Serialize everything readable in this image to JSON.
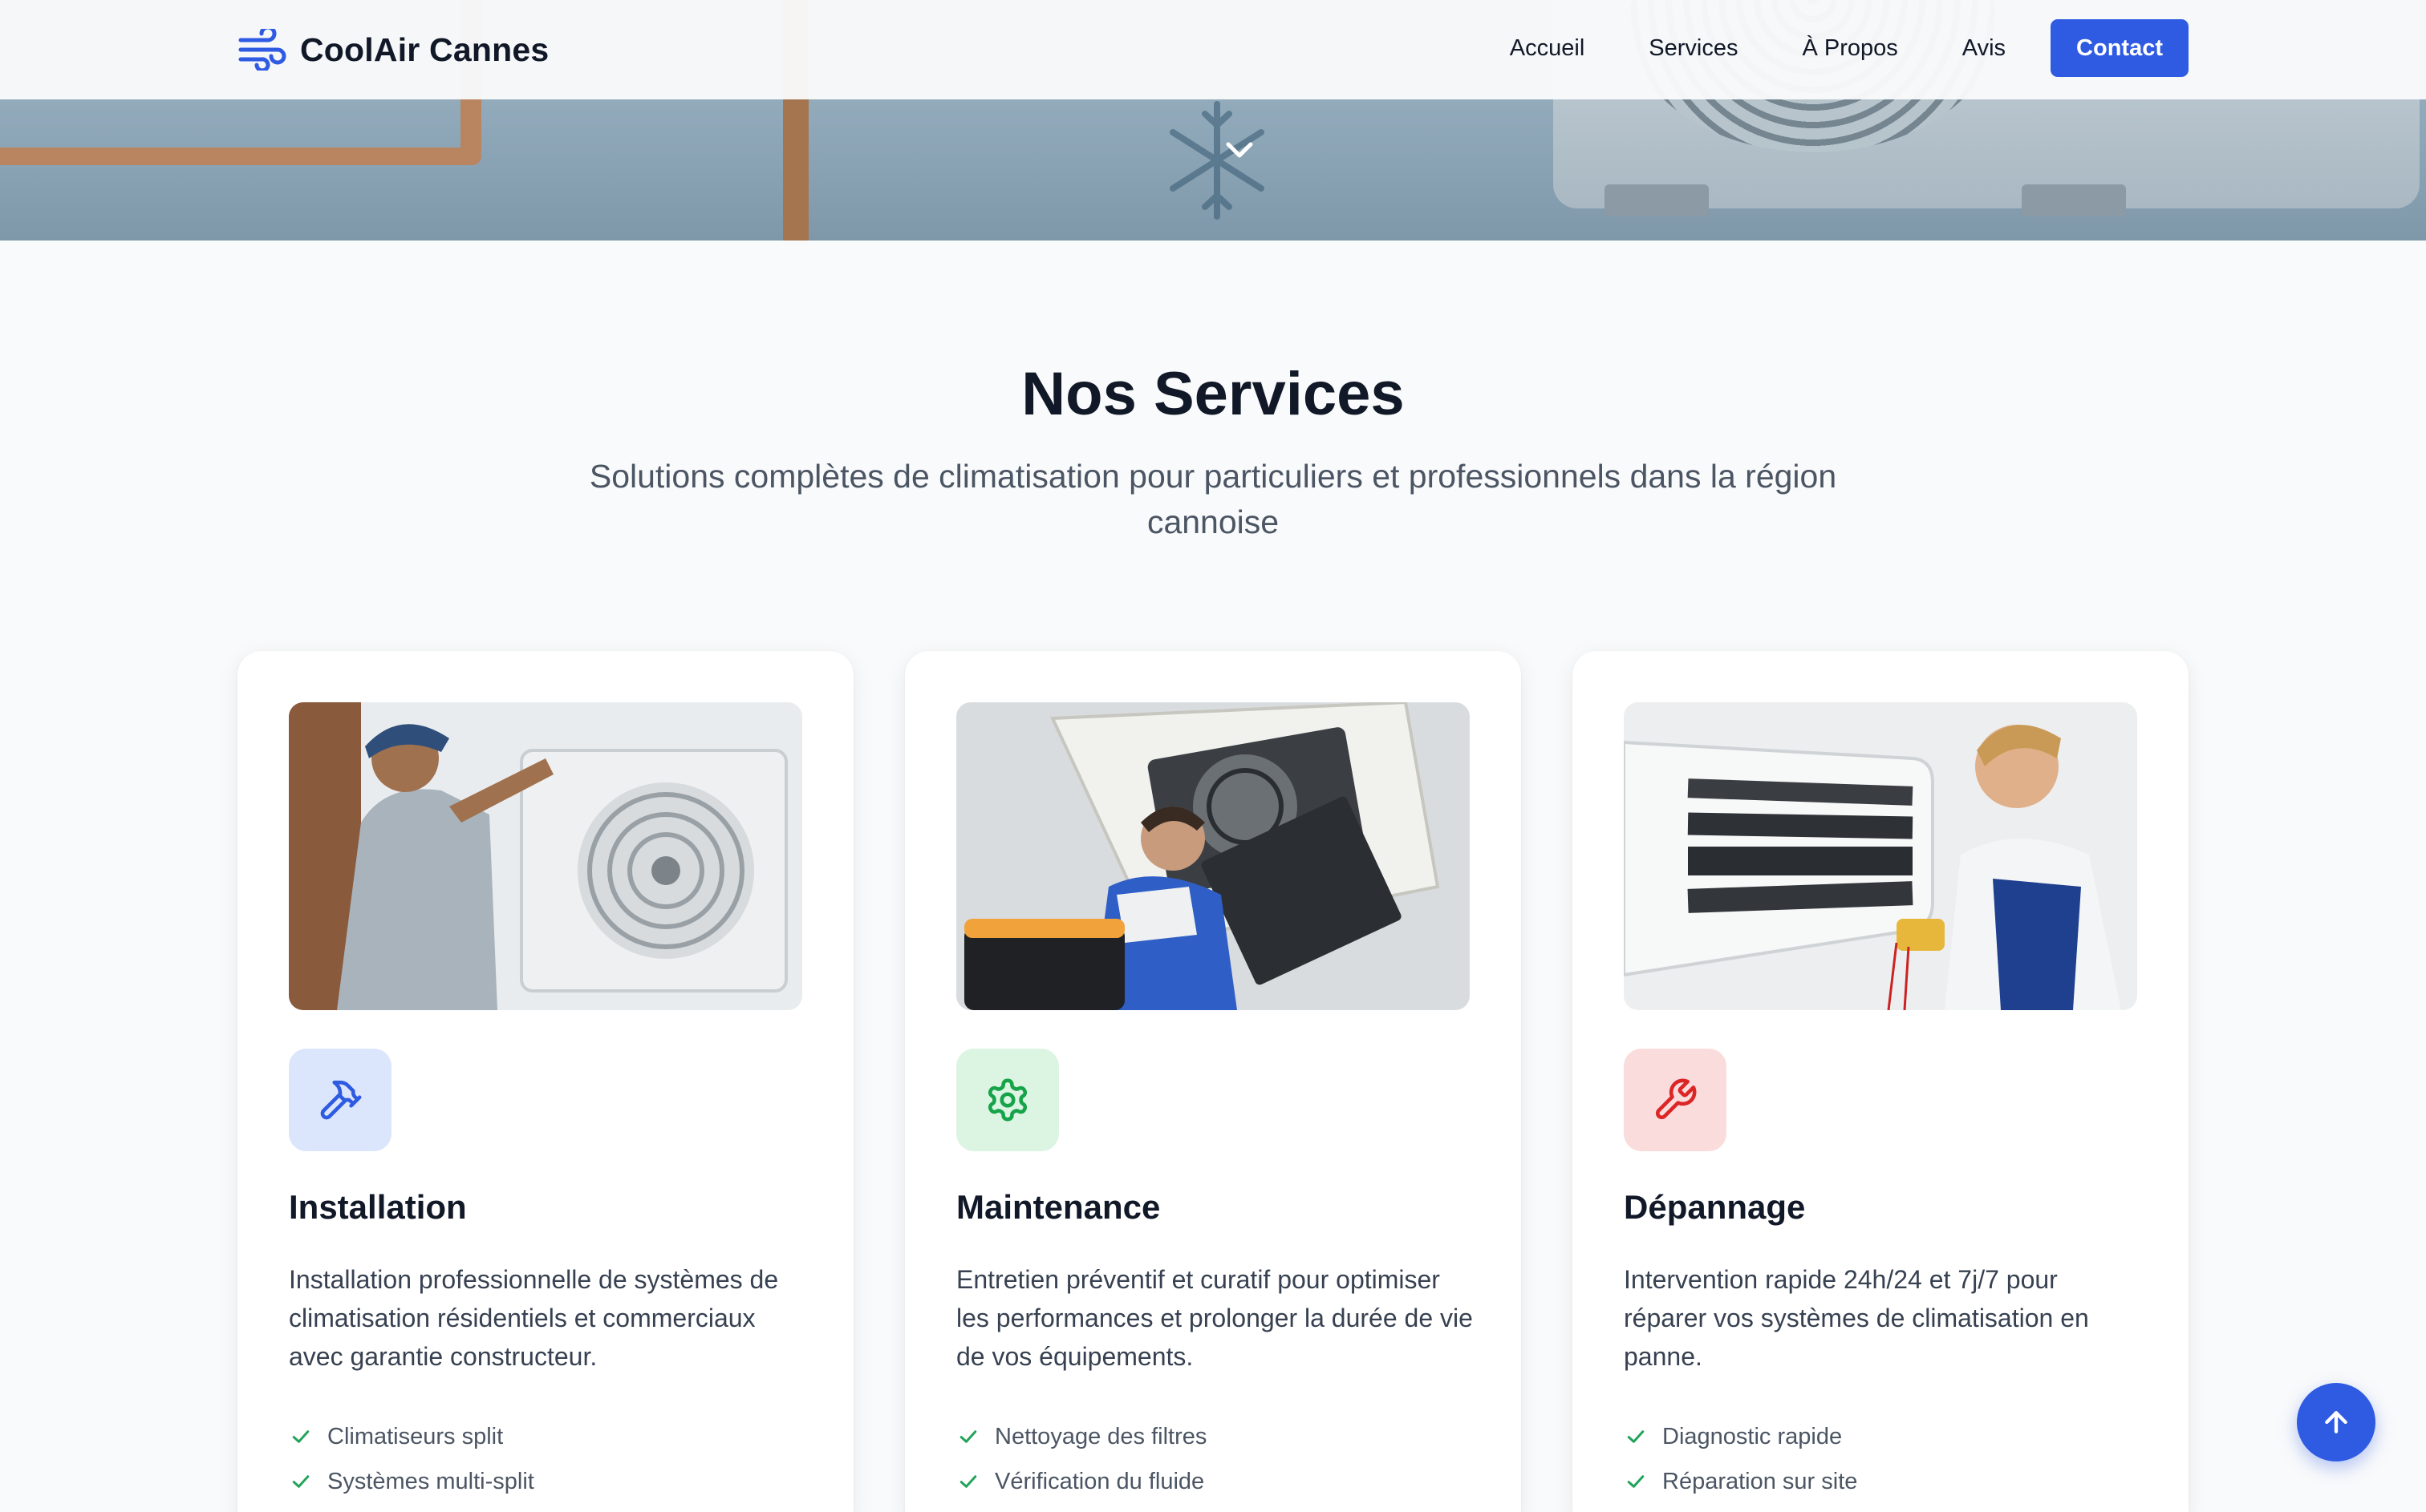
{
  "brand": {
    "name": "CoolAir Cannes",
    "icon": "wind-icon",
    "accent": "#2f5be3"
  },
  "nav": {
    "links": [
      "Accueil",
      "Services",
      "À Propos",
      "Avis"
    ],
    "contact_label": "Contact"
  },
  "hero": {
    "scroll_icon": "chevron-down-icon"
  },
  "services": {
    "title": "Nos Services",
    "subtitle": "Solutions complètes de climatisation pour particuliers et professionnels dans la région cannoise",
    "cards": [
      {
        "icon": "hammer-icon",
        "icon_color": "#2f5be3",
        "title": "Installation",
        "description": "Installation professionnelle de systèmes de climatisation résidentiels et commerciaux avec garantie constructeur.",
        "features": [
          "Climatiseurs split",
          "Systèmes multi-split"
        ]
      },
      {
        "icon": "gear-icon",
        "icon_color": "#16a34a",
        "title": "Maintenance",
        "description": "Entretien préventif et curatif pour optimiser les performances et prolonger la durée de vie de vos équipements.",
        "features": [
          "Nettoyage des filtres",
          "Vérification du fluide"
        ]
      },
      {
        "icon": "wrench-icon",
        "icon_color": "#dc2626",
        "title": "Dépannage",
        "description": "Intervention rapide 24h/24 et 7j/7 pour réparer vos systèmes de climatisation en panne.",
        "features": [
          "Diagnostic rapide",
          "Réparation sur site"
        ]
      }
    ]
  },
  "scroll_top": {
    "icon": "arrow-up-icon"
  }
}
